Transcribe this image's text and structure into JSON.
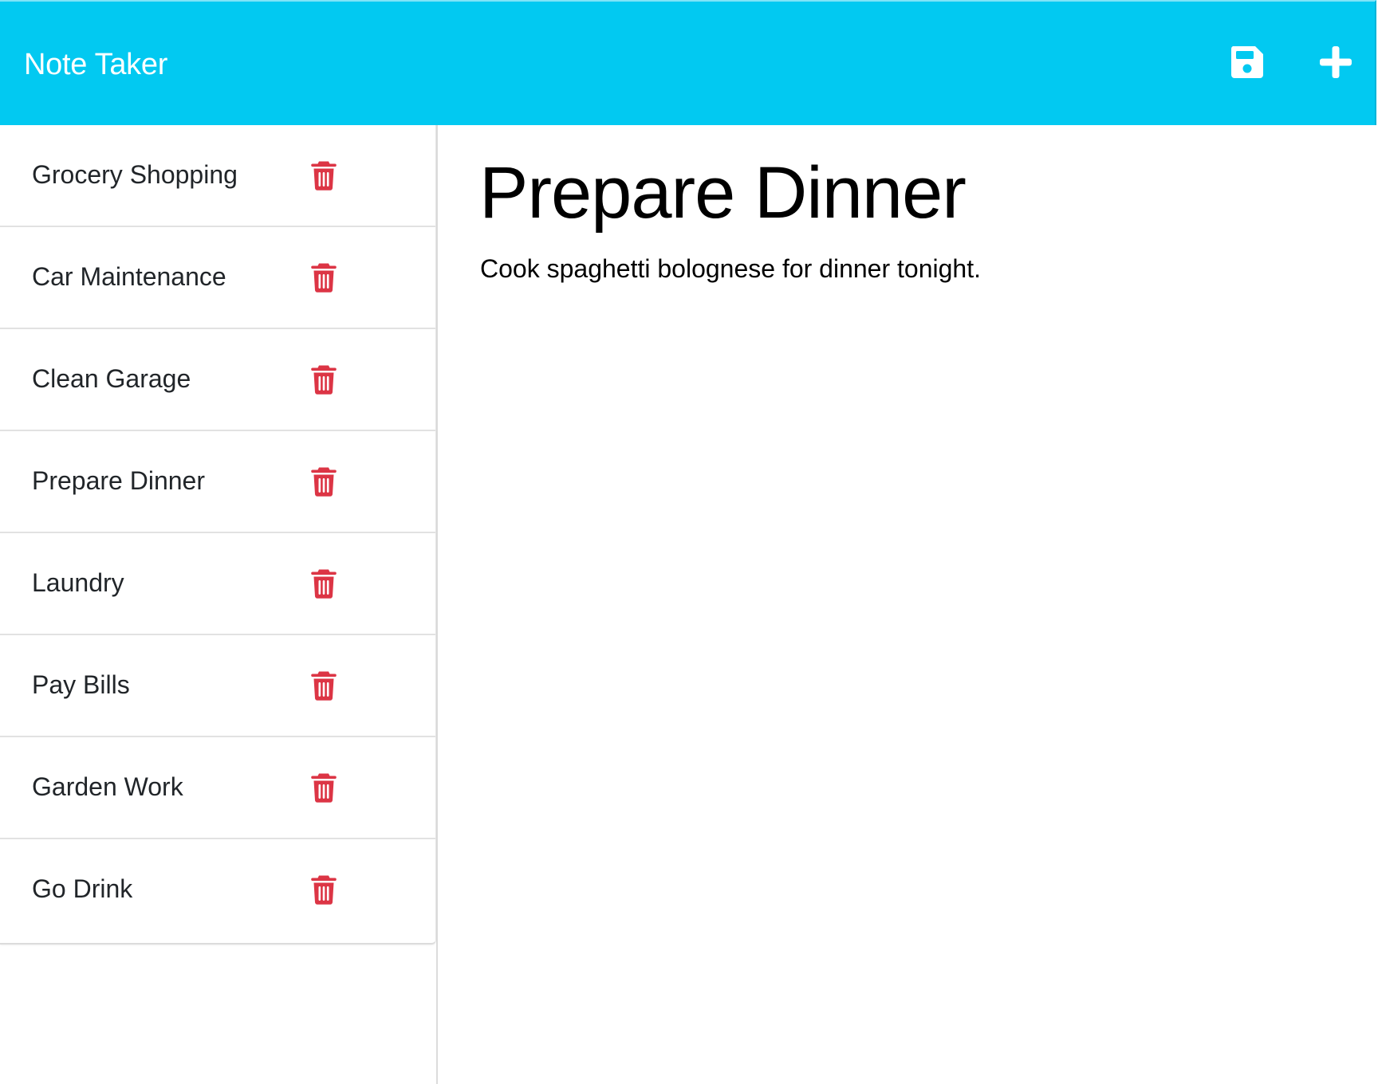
{
  "app": {
    "title": "Note Taker"
  },
  "toolbar": {
    "save_icon": "floppy-disk-icon",
    "new_icon": "plus-icon",
    "icon_color": "#ffffff",
    "bar_color": "#02c9f1"
  },
  "sidebar": {
    "delete_icon": "trash-icon",
    "delete_color": "#dc3545",
    "notes": [
      {
        "title": "Grocery Shopping"
      },
      {
        "title": "Car Maintenance"
      },
      {
        "title": "Clean Garage"
      },
      {
        "title": "Prepare Dinner"
      },
      {
        "title": "Laundry"
      },
      {
        "title": "Pay Bills"
      },
      {
        "title": "Garden Work"
      },
      {
        "title": "Go Drink"
      }
    ]
  },
  "editor": {
    "title": "Prepare Dinner",
    "text": "Cook spaghetti bolognese for dinner tonight."
  }
}
